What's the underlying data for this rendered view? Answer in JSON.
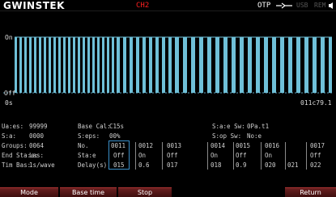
{
  "header": {
    "logo": "GWINSTEK",
    "channel": "CH2",
    "otp_label": "OTP",
    "usb_label": "USB",
    "remote_label": "REM"
  },
  "waveform": {
    "on_label": "On",
    "off_label": "Off",
    "start_label": "0s",
    "end_label": "011c79.1",
    "trace_color": "#6fc0d8"
  },
  "info": {
    "left": [
      {
        "label": "Ua:es:",
        "value": "99999"
      },
      {
        "label": "S:a:",
        "value": "0000"
      },
      {
        "label": "Groups:",
        "value": "0064"
      },
      {
        "label": "End Sta:e:",
        "value": "Las:"
      },
      {
        "label": "Tim Bas:",
        "value": "1s/wave"
      }
    ],
    "middle": [
      {
        "label": "Base Cal:",
        "value": "C15s"
      },
      {
        "label": "S:eps:",
        "value": "00%"
      },
      {
        "label": "No.",
        "value": ""
      },
      {
        "label": "Sta:e",
        "value": ""
      },
      {
        "label": "Delay(s)",
        "value": ""
      }
    ],
    "right": [
      {
        "label": "S:a:e Sw:",
        "value": "0Pa.t1"
      },
      {
        "label": "S:op Sw:",
        "value": "No:e"
      }
    ],
    "grid_numbers": [
      "0011",
      "0012",
      "0013",
      "0014",
      "0015",
      "0016",
      "0017"
    ],
    "grid_states": [
      "Off",
      "On",
      "Off",
      "On",
      "Off",
      "On",
      "Off"
    ],
    "grid_delays": [
      "015",
      "0.6",
      "017",
      "018",
      "0.9",
      "020",
      "021",
      "022"
    ]
  },
  "softkeys": {
    "mode": "Mode",
    "base_time": "Base time",
    "stop": "Stop",
    "return": "Return"
  }
}
